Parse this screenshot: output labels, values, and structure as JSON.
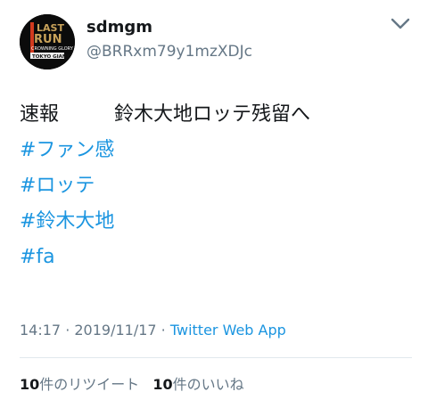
{
  "user": {
    "display_name": "sdmgm",
    "handle": "@BRRxm79y1mzXDJc",
    "avatar_logo": [
      "THE LAST",
      "RUN",
      "CROWNING GLORY",
      "TOKYO GIANTS"
    ]
  },
  "tweet": {
    "line1_left": "速報",
    "line1_right": "鈴木大地ロッテ残留へ",
    "hashtags": [
      "#ファン感",
      "#ロッテ",
      "#鈴木大地",
      "#fa"
    ]
  },
  "meta": {
    "time": "14:17",
    "separator": " · ",
    "date": "2019/11/17",
    "source": "Twitter Web App"
  },
  "stats": {
    "retweets_count": "10",
    "retweets_label": "件のリツイート",
    "likes_count": "10",
    "likes_label": "件のいいね"
  },
  "icons": {
    "more": "chevron-down-icon"
  },
  "colors": {
    "link": "#1b95e0",
    "muted": "#657786",
    "text": "#14171a",
    "divider": "#e1e8ed"
  }
}
